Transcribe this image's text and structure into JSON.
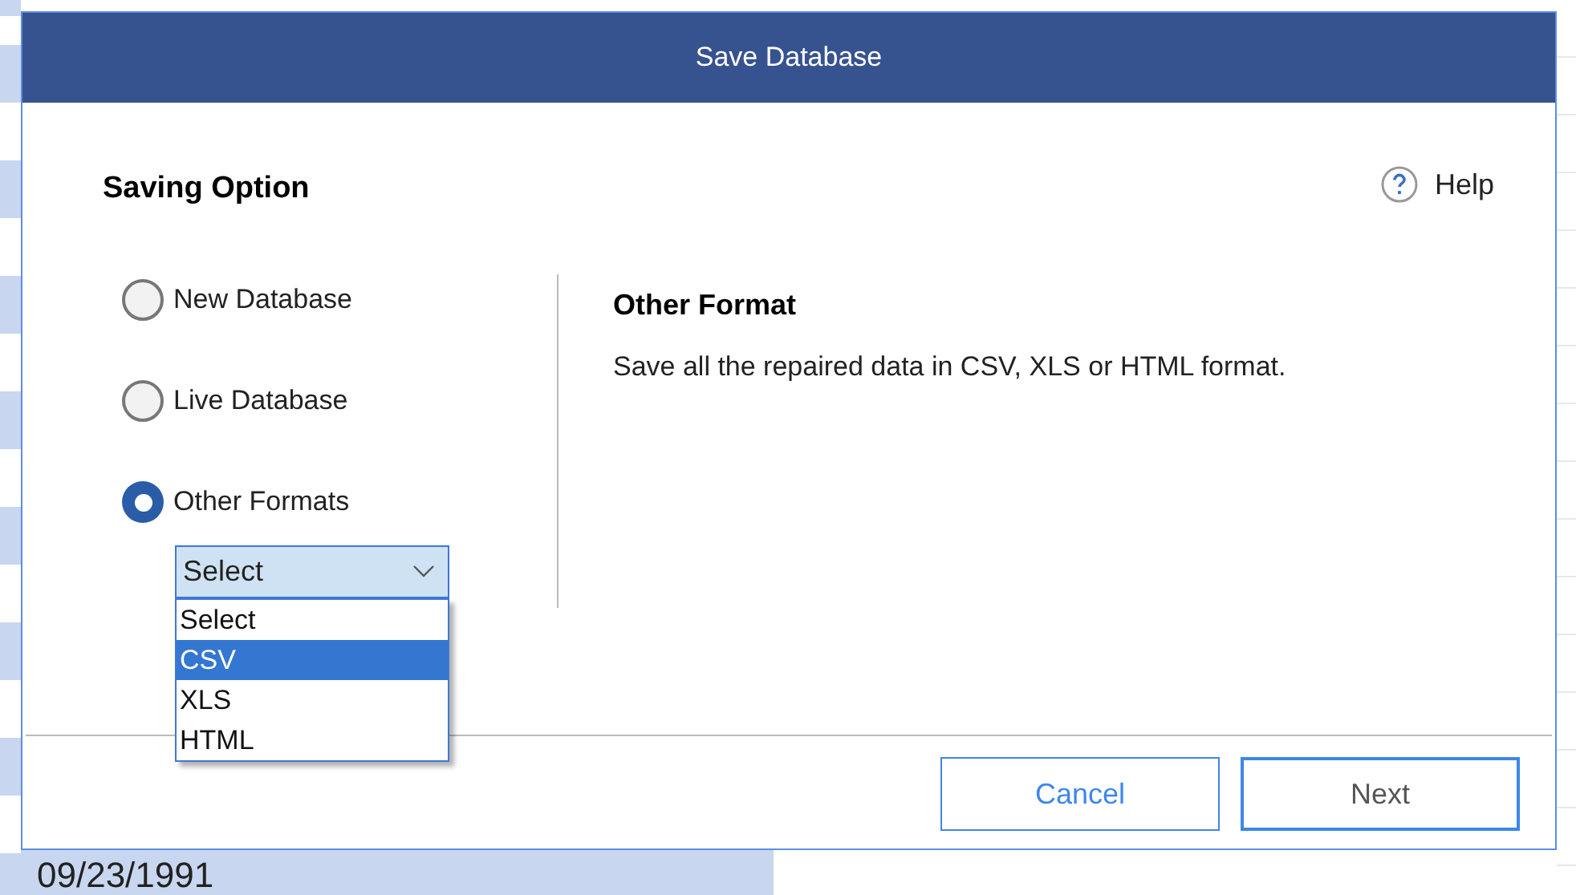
{
  "background": {
    "date_cell": "09/23/1991"
  },
  "dialog": {
    "title": "Save Database",
    "heading": "Saving Option",
    "help": "Help",
    "options": [
      {
        "label": "New Database",
        "selected": false
      },
      {
        "label": "Live Database",
        "selected": false
      },
      {
        "label": "Other Formats",
        "selected": true
      }
    ],
    "format_select": {
      "value": "Select",
      "expanded": true,
      "items": [
        {
          "label": "Select",
          "highlighted": false
        },
        {
          "label": "CSV",
          "highlighted": true
        },
        {
          "label": "XLS",
          "highlighted": false
        },
        {
          "label": "HTML",
          "highlighted": false
        }
      ]
    },
    "detail": {
      "title": "Other Format",
      "description": "Save all the repaired data in CSV, XLS or HTML format."
    },
    "buttons": [
      {
        "label": "Cancel",
        "kind": "secondary"
      },
      {
        "label": "Next",
        "kind": "primary"
      }
    ]
  }
}
